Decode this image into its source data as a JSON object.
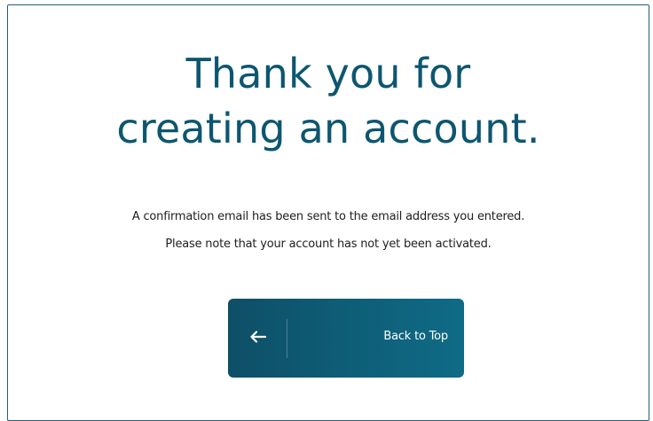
{
  "hero": {
    "title_line1": "Thank you for",
    "title_line2": "creating an account."
  },
  "message": {
    "line1": "A confirmation email has been sent to the email address you entered.",
    "line2": "Please note that your account has not yet been activated."
  },
  "back_button": {
    "label": "Back to Top",
    "icon": "arrow-left-icon"
  },
  "colors": {
    "title": "#0d5670",
    "button_start": "#0e4f67",
    "button_end": "#0f6b86",
    "frame_border": "#1f5f78"
  }
}
